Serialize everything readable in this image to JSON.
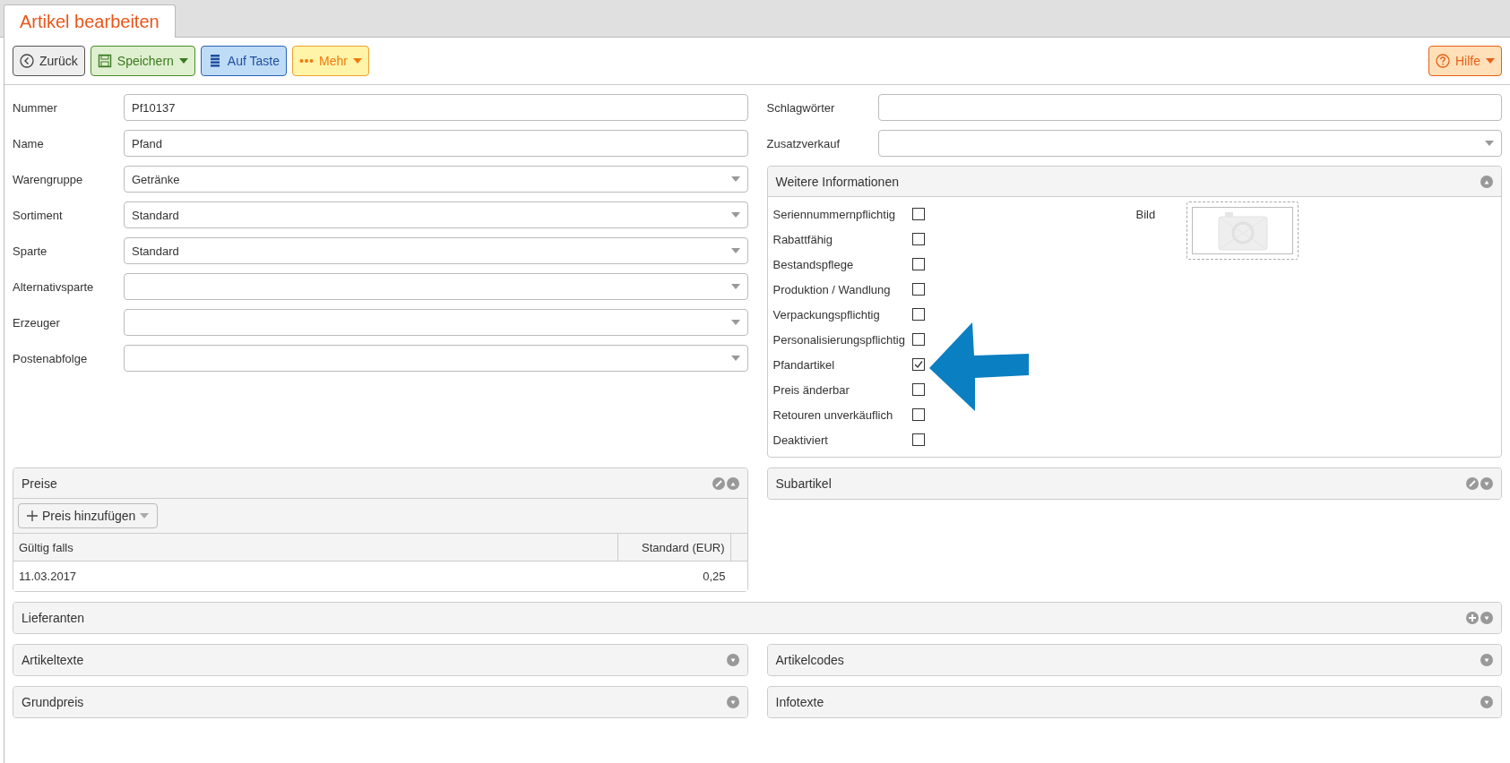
{
  "tab": {
    "label": "Artikel bearbeiten",
    "selected": true
  },
  "toolbar": {
    "buttons": [
      {
        "label": "Zurück",
        "kind": "back",
        "dropdown": false
      },
      {
        "label": "Speichern",
        "kind": "save",
        "dropdown": true
      },
      {
        "label": "Auf Taste",
        "kind": "key",
        "dropdown": false
      },
      {
        "label": "Mehr",
        "kind": "more",
        "dropdown": true
      }
    ],
    "help": {
      "label": "Hilfe",
      "dropdown": true
    }
  },
  "fields_left": [
    {
      "label": "Nummer",
      "kind": "text",
      "value": "Pf10137"
    },
    {
      "label": "Name",
      "kind": "text",
      "value": "Pfand"
    },
    {
      "label": "Warengruppe",
      "kind": "select",
      "value": "Getränke"
    },
    {
      "label": "Sortiment",
      "kind": "select",
      "value": "Standard"
    },
    {
      "label": "Sparte",
      "kind": "select",
      "value": "Standard"
    },
    {
      "label": "Alternativsparte",
      "kind": "select"
    },
    {
      "label": "Erzeuger",
      "kind": "select"
    },
    {
      "label": "Postenabfolge",
      "kind": "select"
    }
  ],
  "fields_right": [
    {
      "label": "Schlagwörter",
      "kind": "text"
    },
    {
      "label": "Zusatzverkauf",
      "kind": "select"
    }
  ],
  "info_panel": {
    "title": "Weitere Informationen",
    "expanded": true,
    "image_label": "Bild",
    "checkboxes": [
      {
        "label": "Seriennummernpflichtig",
        "checked": false
      },
      {
        "label": "Rabattfähig",
        "checked": false
      },
      {
        "label": "Bestandspflege",
        "checked": false
      },
      {
        "label": "Produktion / Wandlung",
        "checked": false
      },
      {
        "label": "Verpackungspflichtig",
        "checked": false
      },
      {
        "label": "Personalisierungspflichtig",
        "checked": false
      },
      {
        "label": "Pfandartikel",
        "checked": true
      },
      {
        "label": "Preis änderbar",
        "checked": false
      },
      {
        "label": "Retouren unverkäuflich",
        "checked": false
      },
      {
        "label": "Deaktiviert",
        "checked": false
      }
    ]
  },
  "prices": {
    "title": "Preise",
    "expanded": true,
    "kind": "editable",
    "add_button": "Preis hinzufügen",
    "columns": [
      "Gültig falls",
      "Standard (EUR)"
    ],
    "rows": [
      [
        "11.03.2017",
        "0,25"
      ]
    ]
  },
  "subarticles": {
    "title": "Subartikel",
    "expanded": false,
    "kind": "editable"
  },
  "suppliers": {
    "title": "Lieferanten",
    "expanded": false,
    "kind": "movable"
  },
  "bottom_panels": [
    {
      "title": "Artikeltexte",
      "expanded": false
    },
    {
      "title": "Artikelcodes",
      "expanded": false
    },
    {
      "title": "Grundpreis",
      "expanded": false
    },
    {
      "title": "Infotexte",
      "expanded": false
    }
  ]
}
